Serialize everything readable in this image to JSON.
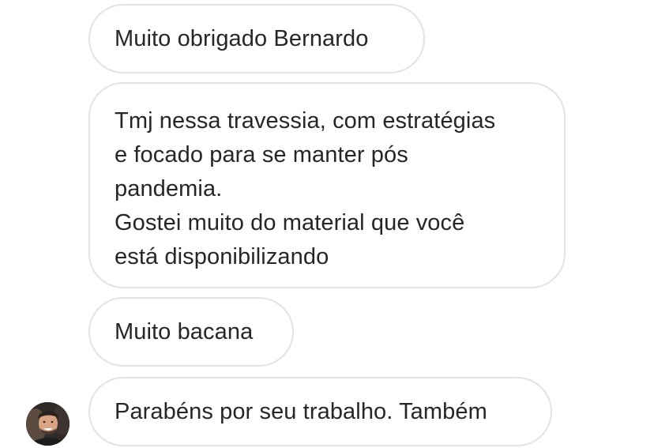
{
  "messages": [
    {
      "text": "Muito obrigado Bernardo"
    },
    {
      "lines": [
        "Tmj nessa travessia, com estratégias",
        "e focado para se manter pós",
        "pandemia.",
        "Gostei muito do material que você",
        "está disponibilizando"
      ]
    },
    {
      "text": "Muito bacana"
    },
    {
      "text": "Parabéns por seu trabalho. Também"
    }
  ],
  "colors": {
    "bubble_border": "#e3e3e3",
    "text": "#262626",
    "background": "#ffffff"
  },
  "icons": {
    "sender_avatar": "avatar-photo"
  }
}
